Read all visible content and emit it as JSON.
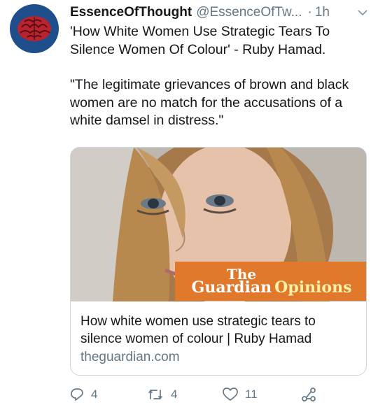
{
  "tweet": {
    "display_name": "EssenceOfThought",
    "handle": "@EssenceOfTw...",
    "separator": "·",
    "time": "1h",
    "paragraphs": [
      "'How White Women Use Strategic Tears To Silence Women Of Colour' - Ruby Hamad.",
      "\"The legitimate grievances of brown and black women are no match for the accusations of a white damsel in distress.\""
    ]
  },
  "card": {
    "brand_the": "The",
    "brand_name": "Guardian",
    "brand_section": "Opinions",
    "title": "How white women use strategic tears to silence women of colour | Ruby Hamad",
    "domain": "theguardian.com"
  },
  "actions": {
    "replies": "4",
    "retweets": "4",
    "likes": "11"
  },
  "colors": {
    "text": "#14171a",
    "muted": "#657786",
    "border": "#ccd6dd",
    "guardian_orange": "#e1792c",
    "avatar_bg": "#1f4e8c",
    "brain": "#b8232f"
  },
  "icons": {
    "avatar": "brain-icon",
    "caret": "chevron-down-icon",
    "reply": "reply-icon",
    "retweet": "retweet-icon",
    "like": "heart-icon",
    "share": "share-icon"
  }
}
